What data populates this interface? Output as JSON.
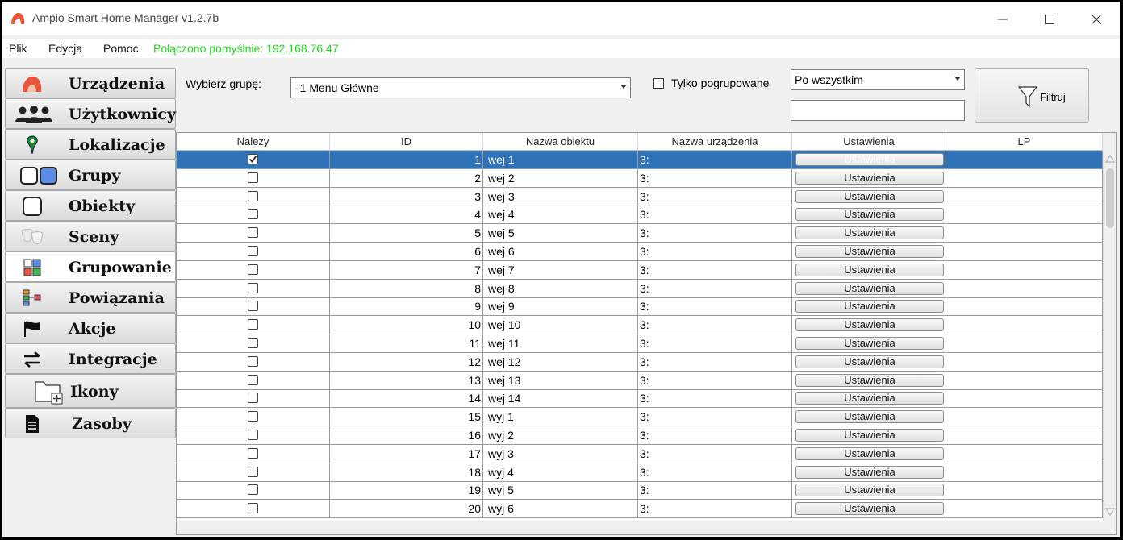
{
  "window": {
    "title": "Ampio Smart Home Manager v1.2.7b"
  },
  "menu": {
    "items": [
      "Plik",
      "Edycja",
      "Pomoc"
    ],
    "status": "Połączono pomyślnie: 192.168.76.47",
    "status_color": "#1ed81e"
  },
  "sidebar": {
    "items": [
      {
        "label": "Urządzenia",
        "icon": "ampio-logo-icon",
        "active": false
      },
      {
        "label": "Użytkownicy",
        "icon": "users-icon",
        "active": false
      },
      {
        "label": "Lokalizacje",
        "icon": "map-pin-icon",
        "active": false
      },
      {
        "label": "Grupy",
        "icon": "groups-icon",
        "active": false
      },
      {
        "label": "Obiekty",
        "icon": "object-square-icon",
        "active": false
      },
      {
        "label": "Sceny",
        "icon": "theater-masks-icon",
        "active": false
      },
      {
        "label": "Grupowanie",
        "icon": "grouping-grid-icon",
        "active": true
      },
      {
        "label": "Powiązania",
        "icon": "relations-icon",
        "active": false
      },
      {
        "label": "Akcje",
        "icon": "flag-icon",
        "active": false
      },
      {
        "label": "Integracje",
        "icon": "exchange-arrows-icon",
        "active": false
      },
      {
        "label": "Ikony",
        "icon": "folder-add-icon",
        "active": false
      },
      {
        "label": "Zasoby",
        "icon": "document-icon",
        "active": false
      }
    ]
  },
  "controls": {
    "group_label": "Wybierz grupę:",
    "group_value": "-1 Menu Główne",
    "grouped_only_label": "Tylko pogrupowane",
    "grouped_only_checked": false,
    "sort_value": "Po wszystkim",
    "filter_text": "",
    "filter_button": "Filtruj"
  },
  "table": {
    "columns": [
      "Należy",
      "ID",
      "Nazwa obiektu",
      "Nazwa urządzenia",
      "Ustawienia",
      "LP"
    ],
    "settings_label": "Ustawienia",
    "selected_index": 0,
    "rows": [
      {
        "checked": true,
        "id": "1",
        "name": "wej 1",
        "device": "3:",
        "lp": ""
      },
      {
        "checked": false,
        "id": "2",
        "name": "wej 2",
        "device": "3:",
        "lp": ""
      },
      {
        "checked": false,
        "id": "3",
        "name": "wej 3",
        "device": "3:",
        "lp": ""
      },
      {
        "checked": false,
        "id": "4",
        "name": "wej 4",
        "device": "3:",
        "lp": ""
      },
      {
        "checked": false,
        "id": "5",
        "name": "wej 5",
        "device": "3:",
        "lp": ""
      },
      {
        "checked": false,
        "id": "6",
        "name": "wej 6",
        "device": "3:",
        "lp": ""
      },
      {
        "checked": false,
        "id": "7",
        "name": "wej 7",
        "device": "3:",
        "lp": ""
      },
      {
        "checked": false,
        "id": "8",
        "name": "wej 8",
        "device": "3:",
        "lp": ""
      },
      {
        "checked": false,
        "id": "9",
        "name": "wej 9",
        "device": "3:",
        "lp": ""
      },
      {
        "checked": false,
        "id": "10",
        "name": "wej 10",
        "device": "3:",
        "lp": ""
      },
      {
        "checked": false,
        "id": "11",
        "name": "wej 11",
        "device": "3:",
        "lp": ""
      },
      {
        "checked": false,
        "id": "12",
        "name": "wej 12",
        "device": "3:",
        "lp": ""
      },
      {
        "checked": false,
        "id": "13",
        "name": "wej 13",
        "device": "3:",
        "lp": ""
      },
      {
        "checked": false,
        "id": "14",
        "name": "wej 14",
        "device": "3:",
        "lp": ""
      },
      {
        "checked": false,
        "id": "15",
        "name": "wyj 1",
        "device": "3:",
        "lp": ""
      },
      {
        "checked": false,
        "id": "16",
        "name": "wyj 2",
        "device": "3:",
        "lp": ""
      },
      {
        "checked": false,
        "id": "17",
        "name": "wyj 3",
        "device": "3:",
        "lp": ""
      },
      {
        "checked": false,
        "id": "18",
        "name": "wyj 4",
        "device": "3:",
        "lp": ""
      },
      {
        "checked": false,
        "id": "19",
        "name": "wyj 5",
        "device": "3:",
        "lp": ""
      },
      {
        "checked": false,
        "id": "20",
        "name": "wyj 6",
        "device": "3:",
        "lp": ""
      }
    ]
  }
}
